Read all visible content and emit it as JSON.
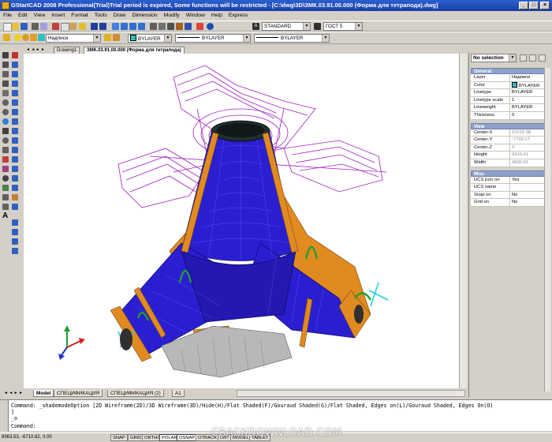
{
  "title": "GStarICAD 2008 Professional(Trial)Trial period is expired, Some functions will be restricted - [C:\\dwg\\3D\\ЗМК.03.91.00.000 (Форма для тетрапода).dwg]",
  "menu": [
    "File",
    "Edit",
    "View",
    "Insert",
    "Format",
    "Tools",
    "Draw",
    "Dimension",
    "Modify",
    "Window",
    "Help",
    "Express"
  ],
  "toolbar": {
    "text_style": "STANDARD",
    "dim_style": "ГОСТ 5",
    "layer": "Надписи",
    "color": "BYLAYER",
    "linetype": "BYLAYER",
    "lineweight": "BYLAYER"
  },
  "doc_tabs": [
    "Drawing1",
    "ЗМК.03.91.00.000 (Форма для тетрапода)"
  ],
  "layout_tabs": [
    "Model",
    "СПЕЦИФИКАЦИЯ",
    "СПЕЦИФИКАЦИЯ (2)",
    "A1"
  ],
  "properties": {
    "selection": "No selection",
    "sections": [
      {
        "name": "General",
        "rows": [
          {
            "k": "Layer",
            "v": "Надписи"
          },
          {
            "k": "Color",
            "v": "BYLAYER",
            "swatch": "#30c0c0"
          },
          {
            "k": "Linetype",
            "v": "BYLAYER"
          },
          {
            "k": "Linetype scale",
            "v": "1"
          },
          {
            "k": "Lineweight",
            "v": "BYLAYER"
          },
          {
            "k": "Thickness",
            "v": "0"
          }
        ]
      },
      {
        "name": "View",
        "rows": [
          {
            "k": "Center-X",
            "v": "10216.38",
            "ro": true
          },
          {
            "k": "Center-Y",
            "v": "-7799.17",
            "ro": true
          },
          {
            "k": "Center-Z",
            "v": "0",
            "ro": true
          },
          {
            "k": "Height",
            "v": "3416.41",
            "ro": true
          },
          {
            "k": "Width",
            "v": "4630.51",
            "ro": true
          }
        ]
      },
      {
        "name": "Misc",
        "rows": [
          {
            "k": "UCS icon on",
            "v": "Yes"
          },
          {
            "k": "UCS name",
            "v": ""
          },
          {
            "k": "Snap on",
            "v": "No"
          },
          {
            "k": "Grid on",
            "v": "No"
          }
        ]
      }
    ]
  },
  "command": {
    "line1": "Command: _shademodeOption [2D Wireframe(2D)/3D Wireframe(3D)/Hide(H)/Flat Shaded(F)/Gouraud Shaded(G)/Flat Shaded, Edges on(L)/Gouraud Shaded, Edges On(O)",
    "line2": "]",
    "line3": "_o",
    "prompt": "Command:"
  },
  "status": {
    "coords": "8963.53, -6710.82, 0.00",
    "buttons": [
      {
        "label": "SNAP",
        "on": false
      },
      {
        "label": "GRID",
        "on": false
      },
      {
        "label": "ORTHO",
        "on": false
      },
      {
        "label": "POLAR",
        "on": true
      },
      {
        "label": "OSNAP",
        "on": true
      },
      {
        "label": "OTRACK",
        "on": false
      },
      {
        "label": "LWT",
        "on": false
      },
      {
        "label": "MODEL",
        "on": false
      },
      {
        "label": "TABLET",
        "on": false
      }
    ]
  },
  "watermark": "CRACKDOWNLOAD.COM",
  "colors": {
    "shell": "#2a1fd0",
    "frame": "#e08a20",
    "wire": "#a020c0",
    "pipe": "#20a030",
    "bolt": "#20d0e0"
  }
}
